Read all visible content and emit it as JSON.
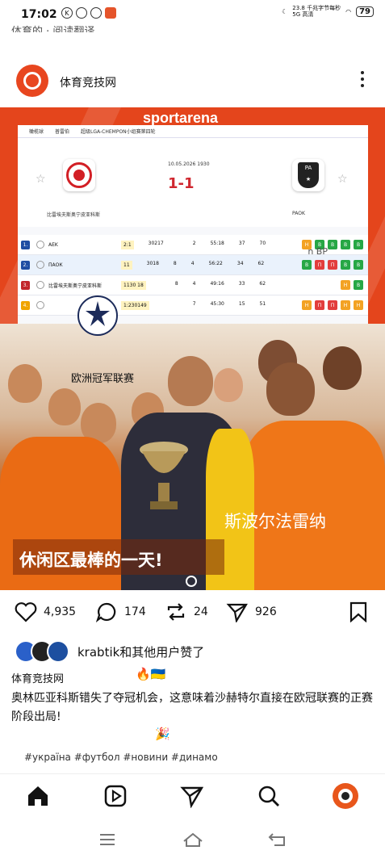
{
  "status": {
    "time": "17:02",
    "speed_top": "23.8 千兆字节每秒",
    "speed_bottom": "5G 高清",
    "battery": "79"
  },
  "top_cut_text": "体育的 · 阅读翻译",
  "post": {
    "author": "体育竞技网"
  },
  "banner": {
    "brand": "sportarena",
    "crumbs": [
      "橄榄球",
      "普雷伯",
      "超级LGA-CHEMPON小组赛第四轮"
    ],
    "match": {
      "date": "10.05.2026 1930",
      "score": "1-1",
      "home": "比雷埃夫斯奥宁皮亚科斯",
      "away": "PAOK"
    },
    "table": [
      {
        "rank": "1.",
        "team": "AEK",
        "col1": "2:1",
        "col2": "30217",
        "col3": "",
        "col4": "2",
        "col5": "55:18",
        "col6": "37",
        "col7": "70",
        "form": [
          "d",
          "w",
          "w",
          "w",
          "w"
        ]
      },
      {
        "rank": "2.",
        "team": "ПАОК",
        "col1": "11",
        "col2": "3018",
        "col3": "8",
        "col4": "4",
        "col5": "56:22",
        "col6": "34",
        "col7": "62",
        "form": [
          "w",
          "l",
          "l",
          "w",
          "w"
        ]
      },
      {
        "rank": "3.",
        "team": "比雷埃夫斯奥宁皮亚科斯",
        "col1": "1130 18",
        "col2": "",
        "col3": "8",
        "col4": "4",
        "col5": "49:16",
        "col6": "33",
        "col7": "62",
        "form": [
          "d",
          "w"
        ]
      },
      {
        "rank": "4.",
        "team": "",
        "col1": "1:230149",
        "col2": "",
        "col3": "",
        "col4": "7",
        "col5": "45:30",
        "col6": "15",
        "col7": "51",
        "form": [
          "d",
          "l",
          "l",
          "d",
          "d"
        ]
      }
    ],
    "overlay_np": "n BP",
    "ucl_caption": "欧洲冠军联赛",
    "caption_right": "斯波尔法雷纳",
    "caption_main": "休闲区最棒的一天!"
  },
  "actions": {
    "likes": "4,935",
    "comments": "174",
    "reposts": "24",
    "shares": "926"
  },
  "liked_by": "krabtik和其他用户赞了",
  "caption": {
    "author": "体育竞技网",
    "emoji": "🔥🇺🇦",
    "body": "奥林匹亚科斯错失了夺冠机会，这意味着沙赫特尔直接在欧冠联赛的正赛阶段出局!",
    "party": "🎉",
    "tags": "#україна #футбол #новини #динамо"
  },
  "colors": {
    "accent": "#e4451c",
    "win": "#27a745",
    "loss": "#e23d3d",
    "draw": "#f3a223"
  }
}
